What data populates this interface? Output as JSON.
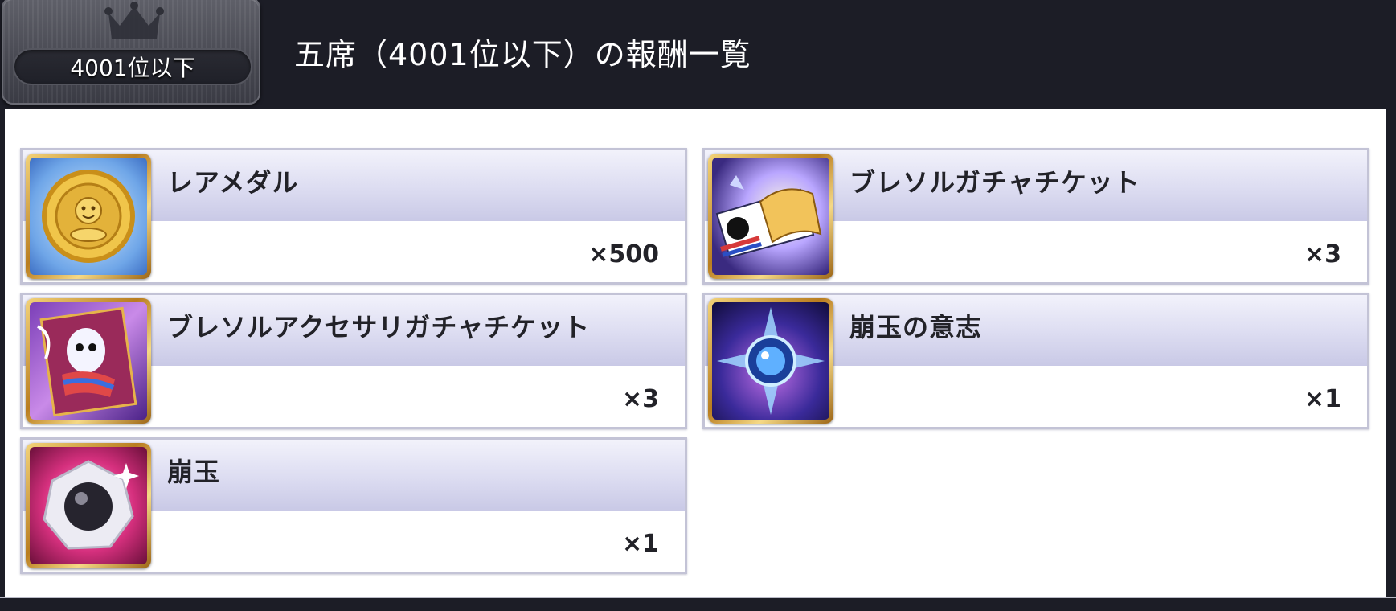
{
  "header": {
    "rank_label": "4001位以下",
    "title": "五席（4001位以下）の報酬一覧"
  },
  "rewards": [
    {
      "name": "レアメダル",
      "quantity": "×500",
      "icon": "rare-medal-icon"
    },
    {
      "name": "ブレソルガチャチケット",
      "quantity": "×3",
      "icon": "gacha-ticket-icon"
    },
    {
      "name": "ブレソルアクセサリガチャチケット",
      "quantity": "×3",
      "icon": "accessory-ticket-icon"
    },
    {
      "name": "崩玉の意志",
      "quantity": "×1",
      "icon": "hogyoku-will-icon"
    },
    {
      "name": "崩玉",
      "quantity": "×1",
      "icon": "hogyoku-icon"
    }
  ],
  "colors": {
    "header_bg": "#1c1d26",
    "card_band": "#dcdcf1",
    "card_border": "#c3c3d6",
    "icon_frame": "#d4a33c"
  }
}
